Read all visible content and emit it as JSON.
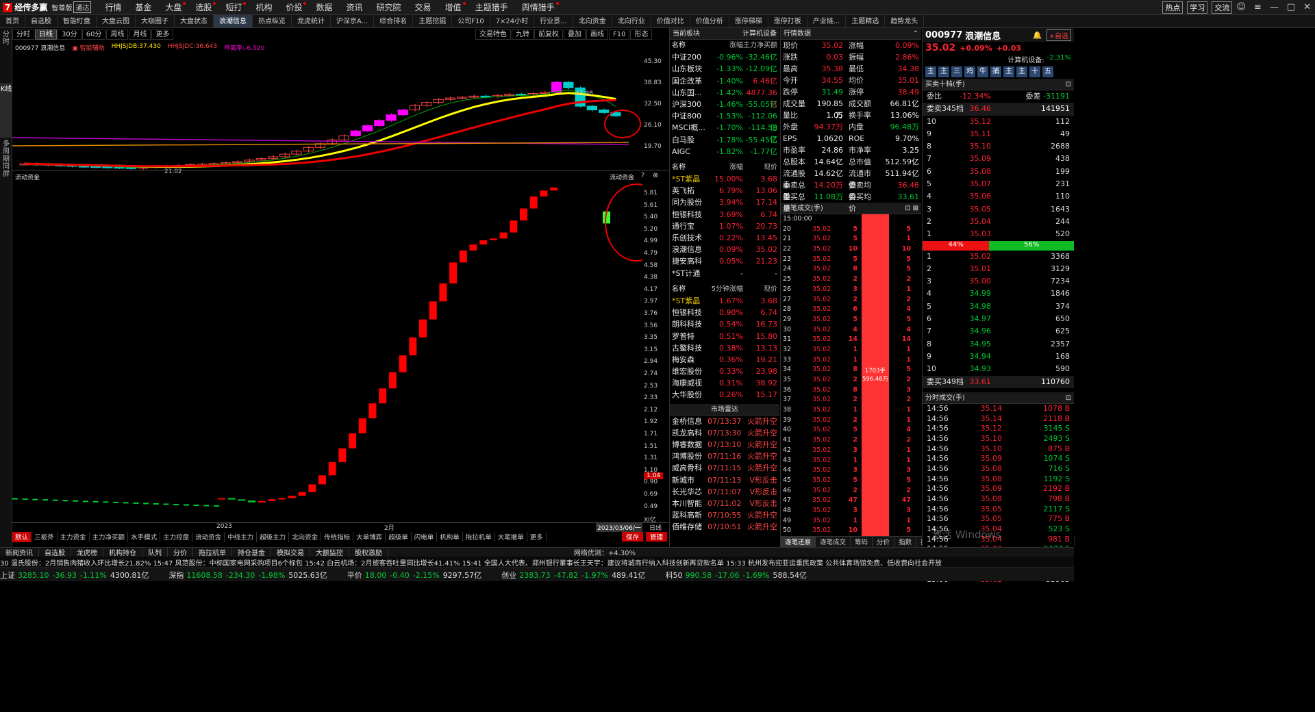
{
  "app": {
    "logo": "经传多赢",
    "edition": "智尊版",
    "edition2": "通达"
  },
  "menu": [
    {
      "t": "行情",
      "r": false
    },
    {
      "t": "基金",
      "r": false
    },
    {
      "t": "大盘",
      "r": true
    },
    {
      "t": "选股",
      "r": true
    },
    {
      "t": "短打",
      "r": true
    },
    {
      "t": "机构",
      "r": false
    },
    {
      "t": "价投",
      "r": true
    },
    {
      "t": "数据",
      "r": false
    },
    {
      "t": "资讯",
      "r": false
    },
    {
      "t": "研究院",
      "r": false
    },
    {
      "t": "交易",
      "r": false
    },
    {
      "t": "增值",
      "r": true
    },
    {
      "t": "主题猎手",
      "r": false
    },
    {
      "t": "舆情猎手",
      "r": true
    }
  ],
  "right_buttons": [
    "热点",
    "学习",
    "交流"
  ],
  "tabs": [
    "首页",
    "自选股",
    "智能盯盘",
    "大盘云图",
    "大咖圈子",
    "大盘状态",
    "浪潮信息",
    "热点纵览",
    "龙虎统计",
    "沪深京A...",
    "综合排名",
    "主题挖掘",
    "公司F10",
    "7×24小时",
    "行业景...",
    "北向资金",
    "北向行业",
    "价值对比",
    "价值分析",
    "涨停梯梯",
    "涨停打板",
    "产业链...",
    "主题精选",
    "趋势龙头"
  ],
  "active_tab": "浪潮信息",
  "left_tabs": [
    {
      "t": "分时"
    },
    {
      "t": "K线"
    },
    {
      "t": "多周期同屏"
    }
  ],
  "period_tabs": [
    "分时",
    "日线",
    "30分",
    "60分",
    "周线",
    "月线",
    "更多"
  ],
  "chart_tools": [
    "交易特色",
    "九转",
    "前复权",
    "叠加",
    "画线",
    "F10",
    "形态"
  ],
  "indicator": {
    "code": "000977 浪潮信息",
    "assist": "智能辅助",
    "a": "HHJSJDB:37.430",
    "b": "HHJSJDC:36.643",
    "c": "乖离率:-6.520"
  },
  "upper_y": [
    "45.30",
    "38.83",
    "32.50",
    "26.10",
    "19.70"
  ],
  "upper_marks": {
    "high": "43.98",
    "low": "21.02"
  },
  "lower_title": "流动资金",
  "lower_title_r": "流动资金",
  "lower_y": [
    "5.81",
    "5.61",
    "5.40",
    "5.20",
    "4.99",
    "4.79",
    "4.58",
    "4.38",
    "4.17",
    "3.97",
    "3.76",
    "3.56",
    "3.35",
    "3.15",
    "2.94",
    "2.74",
    "2.53",
    "2.33",
    "2.12",
    "1.92",
    "1.71",
    "1.51",
    "1.31",
    "1.10",
    "0.90",
    "0.69",
    "0.49",
    "XI亿"
  ],
  "lower_cur": "1.04",
  "x_axis": [
    "2023",
    "2月",
    "2023/03/06/一",
    "日线"
  ],
  "chart_data": {
    "type": "bar",
    "title": "流动资金",
    "ylabel": "亿",
    "ylim": [
      0.49,
      5.81
    ],
    "x": [
      "2023",
      "2月"
    ],
    "series": [
      {
        "name": "流动资金",
        "values": [
          0.62,
          0.6,
          0.58,
          0.55,
          0.57,
          0.6,
          0.62,
          0.66,
          0.72,
          0.85,
          1.0,
          1.22,
          1.45,
          1.7,
          1.95,
          2.2,
          2.45,
          2.72,
          3.0,
          3.3,
          3.6,
          3.9,
          4.2,
          4.55,
          4.75,
          4.85,
          4.92,
          4.95,
          5.05,
          5.25,
          5.45,
          5.65,
          5.75,
          5.8
        ]
      }
    ]
  },
  "bottom_tabs": [
    "默认",
    "三板斧",
    "主力资金",
    "主力净买额",
    "水手模式",
    "主力控盘",
    "流动资金",
    "中线主力",
    "超级主力",
    "北向资金",
    "传统指标",
    "大单博弈",
    "超级单",
    "闪电单",
    "机构单",
    "拖拉机单",
    "大笔撤单",
    "更多"
  ],
  "bottom_btns": [
    "保存",
    "管理"
  ],
  "sector": {
    "title": "当前板块",
    "name": "计算机设备",
    "head": [
      "名称",
      "涨幅",
      "主力净买额"
    ],
    "rows": [
      [
        "中证200",
        "-0.96%",
        "-32.46亿"
      ],
      [
        "山东板块",
        "-1.33%",
        "-12.09亿"
      ],
      [
        "国企改革",
        "-1.40%",
        "6.46亿"
      ],
      [
        "山东国...",
        "-1.42%",
        "4877.36万"
      ],
      [
        "沪深300",
        "-1.46%",
        "-55.05亿"
      ],
      [
        "中证800",
        "-1.53%",
        "-112.06亿"
      ],
      [
        "MSCI概...",
        "-1.70%",
        "-114.59亿"
      ],
      [
        "白马股",
        "-1.78%",
        "-55.45亿"
      ],
      [
        "AIGC",
        "-1.82%",
        "-1.77亿"
      ]
    ]
  },
  "related": {
    "head": [
      "名称",
      "涨幅",
      "现价"
    ],
    "rows": [
      [
        "*ST紫晶",
        "15.00%",
        "3.68"
      ],
      [
        "英飞拓",
        "6.79%",
        "13.06"
      ],
      [
        "同为股份",
        "3.94%",
        "17.14"
      ],
      [
        "恒银科技",
        "3.69%",
        "6.74"
      ],
      [
        "通行宝",
        "1.07%",
        "20.73"
      ],
      [
        "乐创技术",
        "0.22%",
        "13.45"
      ],
      [
        "浪潮信息",
        "0.09%",
        "35.02"
      ],
      [
        "捷安高科",
        "0.05%",
        "21.23"
      ],
      [
        "*ST计通",
        "-",
        "-"
      ]
    ]
  },
  "five_min": {
    "head": [
      "名称",
      "5分钟涨幅",
      "现价"
    ],
    "rows": [
      [
        "*ST紫晶",
        "1.67%",
        "3.68"
      ],
      [
        "恒银科技",
        "0.90%",
        "6.74"
      ],
      [
        "朗科科技",
        "0.54%",
        "16.73"
      ],
      [
        "罗普特",
        "0.51%",
        "15.80"
      ],
      [
        "古鳌科技",
        "0.38%",
        "13.13"
      ],
      [
        "梅安森",
        "0.36%",
        "19.21"
      ],
      [
        "维宏股份",
        "0.33%",
        "23.98"
      ],
      [
        "海康威视",
        "0.31%",
        "38.92"
      ],
      [
        "大华股份",
        "0.26%",
        "15.17"
      ]
    ]
  },
  "radar": {
    "title": "市场雷达",
    "rows": [
      [
        "金桥信息",
        "07/13:37",
        "火箭升空"
      ],
      [
        "凯龙高科",
        "07/13:30",
        "火箭升空"
      ],
      [
        "博睿数据",
        "07/13:10",
        "火箭升空"
      ],
      [
        "鸿博股份",
        "07/11:16",
        "火箭升空"
      ],
      [
        "威高骨科",
        "07/11:15",
        "火箭升空"
      ],
      [
        "新城市",
        "07/11:13",
        "V形反击"
      ],
      [
        "长光华芯",
        "07/11:07",
        "V形反击"
      ],
      [
        "本川智能",
        "07/11:02",
        "V形反击"
      ],
      [
        "蓝科高新",
        "07/10:55",
        "火箭升空"
      ],
      [
        "佰维存储",
        "07/10:51",
        "火箭升空"
      ]
    ]
  },
  "quote": {
    "title": "行情数据",
    "rows": [
      [
        "现价",
        "35.02",
        "涨幅",
        "0.09%"
      ],
      [
        "涨跌",
        "0.03",
        "振幅",
        "2.86%"
      ],
      [
        "最高",
        "35.38",
        "最低",
        "34.38"
      ],
      [
        "今开",
        "34.55",
        "均价",
        "35.01"
      ],
      [
        "跌停",
        "31.49",
        "涨停",
        "38.49"
      ],
      [
        "成交量",
        "190.85万",
        "成交额",
        "66.81亿"
      ],
      [
        "量比",
        "1.05",
        "换手率",
        "13.06%"
      ],
      [
        "外盘",
        "94.37万",
        "内盘",
        "96.48万"
      ],
      [
        "EPS",
        "1.0620",
        "ROE",
        "9.70%"
      ],
      [
        "市盈率",
        "24.86",
        "市净率",
        "3.25"
      ],
      [
        "总股本",
        "14.64亿",
        "总市值",
        "512.59亿"
      ],
      [
        "流通股本",
        "14.62亿",
        "流通市值",
        "511.94亿"
      ],
      [
        "委卖总量",
        "14.20万",
        "委卖均价",
        "36.46"
      ],
      [
        "委买总量",
        "11.08万",
        "委买均价",
        "33.61"
      ]
    ]
  },
  "ticks": {
    "title": "逐笔成交(手)",
    "start": "15:00:00",
    "rows": [
      [
        "20",
        "35.02",
        "5",
        "5"
      ],
      [
        "21",
        "35.02",
        "5",
        "1"
      ],
      [
        "22",
        "35.02",
        "10",
        "10"
      ],
      [
        "23",
        "35.02",
        "5",
        "5"
      ],
      [
        "24",
        "35.02",
        "8",
        "5"
      ],
      [
        "25",
        "35.02",
        "2",
        "2"
      ],
      [
        "26",
        "35.02",
        "3",
        "1"
      ],
      [
        "27",
        "35.02",
        "2",
        "2"
      ],
      [
        "28",
        "35.02",
        "6",
        "4"
      ],
      [
        "29",
        "35.02",
        "5",
        "5"
      ],
      [
        "30",
        "35.02",
        "4",
        "4"
      ],
      [
        "31",
        "35.02",
        "14",
        "14"
      ],
      [
        "32",
        "35.02",
        "1",
        "1"
      ],
      [
        "33",
        "35.02",
        "1",
        "1"
      ],
      [
        "34",
        "35.02",
        "8",
        "5"
      ],
      [
        "35",
        "35.02",
        "2",
        "2"
      ],
      [
        "36",
        "35.02",
        "8",
        "3"
      ],
      [
        "37",
        "35.02",
        "2",
        "2"
      ],
      [
        "38",
        "35.02",
        "1",
        "1"
      ],
      [
        "39",
        "35.02",
        "2",
        "1"
      ],
      [
        "40",
        "35.02",
        "5",
        "4"
      ],
      [
        "41",
        "35.02",
        "2",
        "2"
      ],
      [
        "42",
        "35.02",
        "3",
        "1"
      ],
      [
        "43",
        "35.02",
        "1",
        "1"
      ],
      [
        "44",
        "35.02",
        "3",
        "3"
      ],
      [
        "45",
        "35.02",
        "5",
        "5"
      ],
      [
        "46",
        "35.02",
        "2",
        "2"
      ],
      [
        "47",
        "35.02",
        "47",
        "47"
      ],
      [
        "48",
        "35.02",
        "3",
        "3"
      ],
      [
        "49",
        "35.02",
        "1",
        "1"
      ],
      [
        "50",
        "35.02",
        "10",
        "5"
      ]
    ],
    "big1": "1703手",
    "big2": "596.46万",
    "foot": [
      "逐笔还原",
      "逐笔成交",
      "筹码",
      "分价",
      "指数",
      "操作",
      "风险",
      "股本",
      "异动"
    ]
  },
  "stock": {
    "code": "000977",
    "name": "浪潮信息",
    "price": "35.02",
    "chg": "+0.09%",
    "chgv": "+0.03",
    "add": "自选",
    "sector": "计算机设备:",
    "sector_chg": "-2.31%",
    "btns": [
      "主",
      "主",
      "三",
      "鸡",
      "牛",
      "捕",
      "主",
      "主",
      "十",
      "五"
    ]
  },
  "orderbook": {
    "title": "买卖十档(手)",
    "webi": "委比",
    "webi_v": "-12.34%",
    "wecha": "委差",
    "wecha_v": "-31191",
    "sell_top": [
      "委卖345档",
      "36.46",
      "141951"
    ],
    "sell": [
      [
        "10",
        "35.12",
        "112"
      ],
      [
        "9",
        "35.11",
        "49"
      ],
      [
        "8",
        "35.10",
        "2688"
      ],
      [
        "7",
        "35.09",
        "438"
      ],
      [
        "6",
        "35.08",
        "199"
      ],
      [
        "5",
        "35.07",
        "231"
      ],
      [
        "4",
        "35.06",
        "110"
      ],
      [
        "3",
        "35.05",
        "1643"
      ],
      [
        "2",
        "35.04",
        "244"
      ],
      [
        "1",
        "35.03",
        "520"
      ]
    ],
    "ratio": [
      "44%",
      "56%"
    ],
    "buy": [
      [
        "1",
        "35.02",
        "3368"
      ],
      [
        "2",
        "35.01",
        "3129"
      ],
      [
        "3",
        "35.00",
        "7234"
      ],
      [
        "4",
        "34.99",
        "1846"
      ],
      [
        "5",
        "34.98",
        "374"
      ],
      [
        "6",
        "34.97",
        "650"
      ],
      [
        "7",
        "34.96",
        "625"
      ],
      [
        "8",
        "34.95",
        "2357"
      ],
      [
        "9",
        "34.94",
        "168"
      ],
      [
        "10",
        "34.93",
        "590"
      ]
    ],
    "buy_bottom": [
      "委买349档",
      "33.61",
      "110760"
    ]
  },
  "fenshi": {
    "title": "分时成交(手)",
    "rows": [
      [
        "14:56",
        "35.14",
        "1078 B"
      ],
      [
        "14:56",
        "35.14",
        "2118 B"
      ],
      [
        "14:56",
        "35.12",
        "3145 S"
      ],
      [
        "14:56",
        "35.10",
        "2493 S"
      ],
      [
        "14:56",
        "35.10",
        "875 B"
      ],
      [
        "14:56",
        "35.09",
        "1074 S"
      ],
      [
        "14:56",
        "35.08",
        "716 S"
      ],
      [
        "14:56",
        "35.08",
        "1192 S"
      ],
      [
        "14:56",
        "35.09",
        "2192 B"
      ],
      [
        "14:56",
        "35.08",
        "798 B"
      ],
      [
        "14:56",
        "35.05",
        "2117 S"
      ],
      [
        "14:56",
        "35.05",
        "775 B"
      ],
      [
        "14:56",
        "35.04",
        "523 S"
      ],
      [
        "14:56",
        "35.04",
        "981 B"
      ],
      [
        "14:56",
        "35.03",
        "2437 S"
      ],
      [
        "14:56",
        "35.04",
        "593 B"
      ],
      [
        "14:57",
        "35.05",
        "308 B"
      ],
      [
        "15:00",
        "35.02",
        "33905"
      ]
    ]
  },
  "bottom_bar": [
    "新闻资讯",
    "自选股",
    "龙虎榜",
    "机构持仓",
    "队列",
    "分价",
    "拖拉机单",
    "持仓基金",
    "模拟交易",
    "大额监控",
    "股权激励"
  ],
  "net": "网络优测：+4.30%",
  "news": "30 温氏股份：2月销售肉猪收入环比增长21.82%    15:47 风范股份：中标国家电网采购项目6个标包    15:42 白云机场：2月旅客吞吐量同比增长41.41%    15:41 全国人大代表、郑州银行董事长王天宇：建议将城商行纳入科技创新再贷款名单    15:33 杭州发布迎亚运重民政策 公共体育场馆免费、低收费向社会开放",
  "index": [
    [
      "上证",
      "3285.10",
      "-36.93",
      "-1.11%",
      "4300.81亿"
    ],
    [
      "深指",
      "11608.58",
      "-234.30",
      "-1.98%",
      "5025.63亿"
    ],
    [
      "平价",
      "18.00",
      "-0.40",
      "-2.15%",
      "9297.57亿"
    ],
    [
      "创业",
      "2383.73",
      "-47.82",
      "-1.97%",
      "489.41亿"
    ],
    [
      "科50",
      "990.58",
      "-17.06",
      "-1.69%",
      "588.54亿"
    ]
  ],
  "watermark": "激活 Windows"
}
